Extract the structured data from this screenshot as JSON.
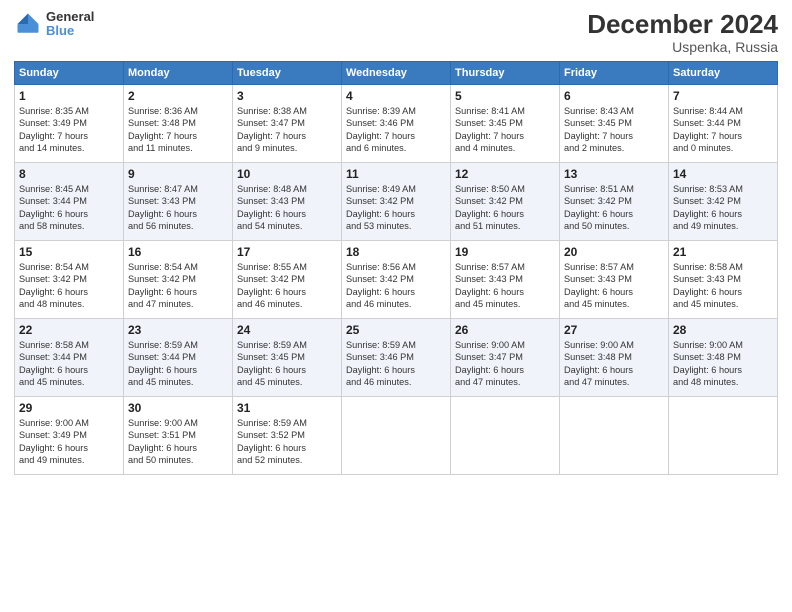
{
  "header": {
    "logo_line1": "General",
    "logo_line2": "Blue",
    "title": "December 2024",
    "subtitle": "Uspenka, Russia"
  },
  "days_of_week": [
    "Sunday",
    "Monday",
    "Tuesday",
    "Wednesday",
    "Thursday",
    "Friday",
    "Saturday"
  ],
  "weeks": [
    [
      {
        "day": "1",
        "lines": [
          "Sunrise: 8:35 AM",
          "Sunset: 3:49 PM",
          "Daylight: 7 hours",
          "and 14 minutes."
        ]
      },
      {
        "day": "2",
        "lines": [
          "Sunrise: 8:36 AM",
          "Sunset: 3:48 PM",
          "Daylight: 7 hours",
          "and 11 minutes."
        ]
      },
      {
        "day": "3",
        "lines": [
          "Sunrise: 8:38 AM",
          "Sunset: 3:47 PM",
          "Daylight: 7 hours",
          "and 9 minutes."
        ]
      },
      {
        "day": "4",
        "lines": [
          "Sunrise: 8:39 AM",
          "Sunset: 3:46 PM",
          "Daylight: 7 hours",
          "and 6 minutes."
        ]
      },
      {
        "day": "5",
        "lines": [
          "Sunrise: 8:41 AM",
          "Sunset: 3:45 PM",
          "Daylight: 7 hours",
          "and 4 minutes."
        ]
      },
      {
        "day": "6",
        "lines": [
          "Sunrise: 8:43 AM",
          "Sunset: 3:45 PM",
          "Daylight: 7 hours",
          "and 2 minutes."
        ]
      },
      {
        "day": "7",
        "lines": [
          "Sunrise: 8:44 AM",
          "Sunset: 3:44 PM",
          "Daylight: 7 hours",
          "and 0 minutes."
        ]
      }
    ],
    [
      {
        "day": "8",
        "lines": [
          "Sunrise: 8:45 AM",
          "Sunset: 3:44 PM",
          "Daylight: 6 hours",
          "and 58 minutes."
        ]
      },
      {
        "day": "9",
        "lines": [
          "Sunrise: 8:47 AM",
          "Sunset: 3:43 PM",
          "Daylight: 6 hours",
          "and 56 minutes."
        ]
      },
      {
        "day": "10",
        "lines": [
          "Sunrise: 8:48 AM",
          "Sunset: 3:43 PM",
          "Daylight: 6 hours",
          "and 54 minutes."
        ]
      },
      {
        "day": "11",
        "lines": [
          "Sunrise: 8:49 AM",
          "Sunset: 3:42 PM",
          "Daylight: 6 hours",
          "and 53 minutes."
        ]
      },
      {
        "day": "12",
        "lines": [
          "Sunrise: 8:50 AM",
          "Sunset: 3:42 PM",
          "Daylight: 6 hours",
          "and 51 minutes."
        ]
      },
      {
        "day": "13",
        "lines": [
          "Sunrise: 8:51 AM",
          "Sunset: 3:42 PM",
          "Daylight: 6 hours",
          "and 50 minutes."
        ]
      },
      {
        "day": "14",
        "lines": [
          "Sunrise: 8:53 AM",
          "Sunset: 3:42 PM",
          "Daylight: 6 hours",
          "and 49 minutes."
        ]
      }
    ],
    [
      {
        "day": "15",
        "lines": [
          "Sunrise: 8:54 AM",
          "Sunset: 3:42 PM",
          "Daylight: 6 hours",
          "and 48 minutes."
        ]
      },
      {
        "day": "16",
        "lines": [
          "Sunrise: 8:54 AM",
          "Sunset: 3:42 PM",
          "Daylight: 6 hours",
          "and 47 minutes."
        ]
      },
      {
        "day": "17",
        "lines": [
          "Sunrise: 8:55 AM",
          "Sunset: 3:42 PM",
          "Daylight: 6 hours",
          "and 46 minutes."
        ]
      },
      {
        "day": "18",
        "lines": [
          "Sunrise: 8:56 AM",
          "Sunset: 3:42 PM",
          "Daylight: 6 hours",
          "and 46 minutes."
        ]
      },
      {
        "day": "19",
        "lines": [
          "Sunrise: 8:57 AM",
          "Sunset: 3:43 PM",
          "Daylight: 6 hours",
          "and 45 minutes."
        ]
      },
      {
        "day": "20",
        "lines": [
          "Sunrise: 8:57 AM",
          "Sunset: 3:43 PM",
          "Daylight: 6 hours",
          "and 45 minutes."
        ]
      },
      {
        "day": "21",
        "lines": [
          "Sunrise: 8:58 AM",
          "Sunset: 3:43 PM",
          "Daylight: 6 hours",
          "and 45 minutes."
        ]
      }
    ],
    [
      {
        "day": "22",
        "lines": [
          "Sunrise: 8:58 AM",
          "Sunset: 3:44 PM",
          "Daylight: 6 hours",
          "and 45 minutes."
        ]
      },
      {
        "day": "23",
        "lines": [
          "Sunrise: 8:59 AM",
          "Sunset: 3:44 PM",
          "Daylight: 6 hours",
          "and 45 minutes."
        ]
      },
      {
        "day": "24",
        "lines": [
          "Sunrise: 8:59 AM",
          "Sunset: 3:45 PM",
          "Daylight: 6 hours",
          "and 45 minutes."
        ]
      },
      {
        "day": "25",
        "lines": [
          "Sunrise: 8:59 AM",
          "Sunset: 3:46 PM",
          "Daylight: 6 hours",
          "and 46 minutes."
        ]
      },
      {
        "day": "26",
        "lines": [
          "Sunrise: 9:00 AM",
          "Sunset: 3:47 PM",
          "Daylight: 6 hours",
          "and 47 minutes."
        ]
      },
      {
        "day": "27",
        "lines": [
          "Sunrise: 9:00 AM",
          "Sunset: 3:48 PM",
          "Daylight: 6 hours",
          "and 47 minutes."
        ]
      },
      {
        "day": "28",
        "lines": [
          "Sunrise: 9:00 AM",
          "Sunset: 3:48 PM",
          "Daylight: 6 hours",
          "and 48 minutes."
        ]
      }
    ],
    [
      {
        "day": "29",
        "lines": [
          "Sunrise: 9:00 AM",
          "Sunset: 3:49 PM",
          "Daylight: 6 hours",
          "and 49 minutes."
        ]
      },
      {
        "day": "30",
        "lines": [
          "Sunrise: 9:00 AM",
          "Sunset: 3:51 PM",
          "Daylight: 6 hours",
          "and 50 minutes."
        ]
      },
      {
        "day": "31",
        "lines": [
          "Sunrise: 8:59 AM",
          "Sunset: 3:52 PM",
          "Daylight: 6 hours",
          "and 52 minutes."
        ]
      },
      null,
      null,
      null,
      null
    ]
  ]
}
